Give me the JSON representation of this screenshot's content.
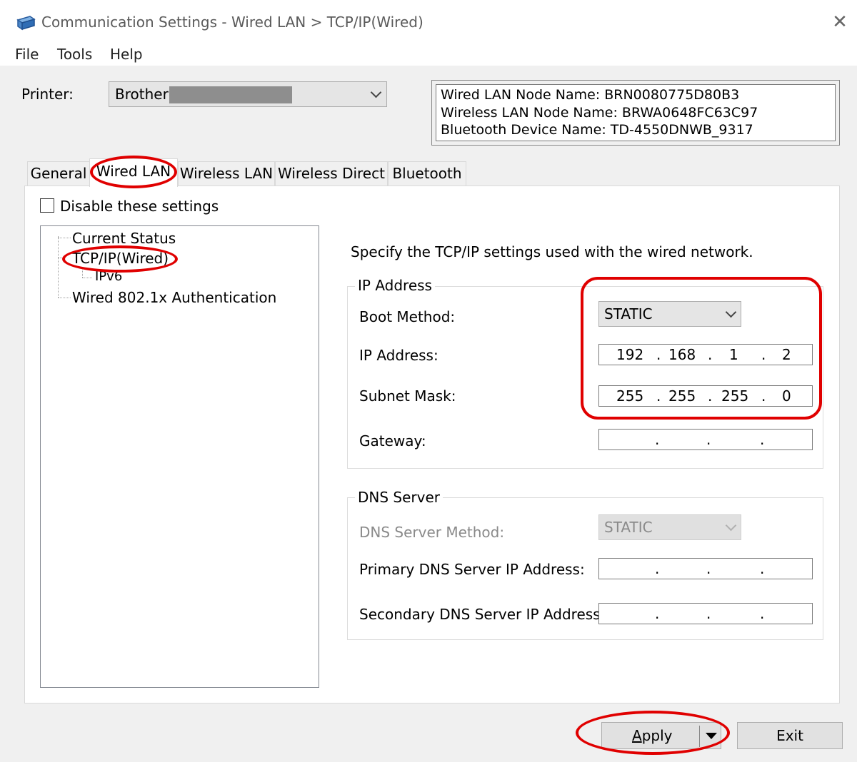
{
  "window": {
    "title": "Communication Settings - Wired LAN > TCP/IP(Wired)",
    "close_glyph": "✕"
  },
  "menu": [
    "File",
    "Tools",
    "Help"
  ],
  "printer": {
    "label": "Printer:",
    "selected": "Brother"
  },
  "node_info": {
    "wired_lan_node_name": "Wired LAN Node Name: BRN0080775D80B3",
    "wireless_lan_node_name": "Wireless LAN Node Name: BRWA0648FC63C97",
    "bluetooth_device_name": "Bluetooth Device Name: TD-4550DNWB_9317"
  },
  "tabs": [
    "General",
    "Wired LAN",
    "Wireless LAN",
    "Wireless Direct",
    "Bluetooth"
  ],
  "active_tab": "Wired LAN",
  "disable_settings": {
    "label": "Disable these settings",
    "checked": false
  },
  "tree": {
    "items": [
      "Current Status",
      "TCP/IP(Wired)",
      "IPv6",
      "Wired 802.1x Authentication"
    ],
    "selected": "TCP/IP(Wired)"
  },
  "tcpip": {
    "description": "Specify the TCP/IP settings used with the wired network.",
    "ip_group": {
      "title": "IP Address",
      "boot_method_label": "Boot Method:",
      "boot_method_value": "STATIC",
      "ip_address_label": "IP Address:",
      "ip_address": [
        "192",
        "168",
        "1",
        "2"
      ],
      "subnet_mask_label": "Subnet Mask:",
      "subnet_mask": [
        "255",
        "255",
        "255",
        "0"
      ],
      "gateway_label": "Gateway:",
      "gateway": [
        "",
        "",
        "",
        ""
      ]
    },
    "dns_group": {
      "title": "DNS Server",
      "method_label": "DNS Server Method:",
      "method_value": "STATIC",
      "primary_label": "Primary DNS Server IP Address:",
      "primary": [
        "",
        "",
        "",
        ""
      ],
      "secondary_label": "Secondary DNS Server IP Address:",
      "secondary": [
        "",
        "",
        "",
        ""
      ]
    }
  },
  "buttons": {
    "apply_first_letter": "A",
    "apply_rest": "pply",
    "exit": "Exit"
  },
  "colors": {
    "annotation": "#e00000",
    "window_bg": "#f0f0f0"
  }
}
